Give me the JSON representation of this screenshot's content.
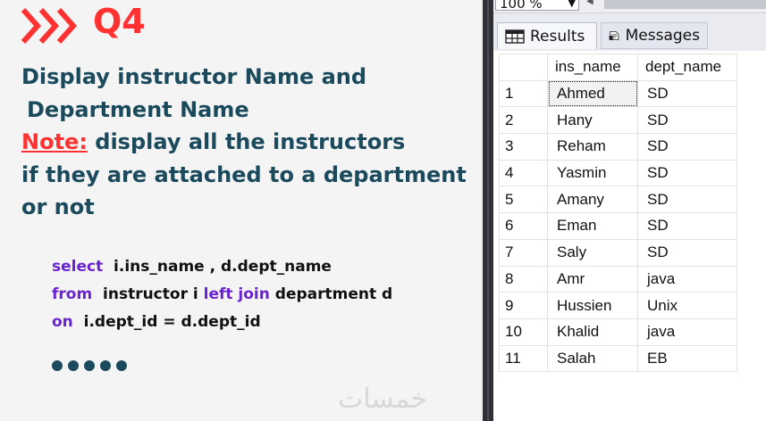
{
  "slide": {
    "question": "Q4",
    "task_lines": [
      "Display instructor Name and",
      "Department Name"
    ],
    "note_label": "Note:",
    "note_rest": " display all the instructors",
    "note_lines": [
      "if they are attached to a department",
      "or not"
    ],
    "code": {
      "line1_kw": "select",
      "line1_text": "  i.ins_name , d.dept_name",
      "line2_kw": "from",
      "line2_text": "  instructor i ",
      "line2_kw2": "left join",
      "line2_text2": " department d",
      "line3_kw": "on",
      "line3_text": "  i.dept_id = d.dept_id"
    },
    "watermark": "خمسات"
  },
  "ssms": {
    "zoom_value": "100 %",
    "tabs": {
      "results": "Results",
      "messages": "Messages"
    },
    "columns": [
      "ins_name",
      "dept_name"
    ],
    "rows": [
      [
        "1",
        "Ahmed",
        "SD"
      ],
      [
        "2",
        "Hany",
        "SD"
      ],
      [
        "3",
        "Reham",
        "SD"
      ],
      [
        "4",
        "Yasmin",
        "SD"
      ],
      [
        "5",
        "Amany",
        "SD"
      ],
      [
        "6",
        "Eman",
        "SD"
      ],
      [
        "7",
        "Saly",
        "SD"
      ],
      [
        "8",
        "Amr",
        "java"
      ],
      [
        "9",
        "Hussien",
        "Unix"
      ],
      [
        "10",
        "Khalid",
        "java"
      ],
      [
        "11",
        "Salah",
        "EB"
      ]
    ]
  },
  "colors": {
    "accent_red": "#ff3131",
    "heading_teal": "#1a4a5c",
    "keyword_purple": "#6a23d1"
  },
  "icons": [
    "chevrons-right-icon",
    "grid-icon",
    "messages-icon"
  ]
}
